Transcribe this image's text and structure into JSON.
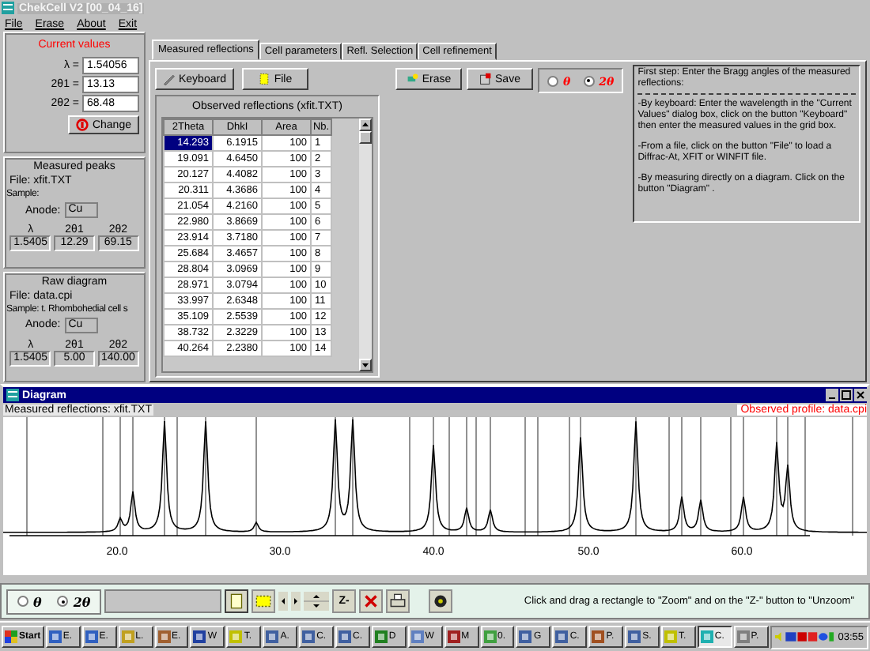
{
  "window": {
    "title": "ChekCell V2 [00_04_16]"
  },
  "menu": [
    "File",
    "Erase",
    "About",
    "Exit"
  ],
  "current_values": {
    "title": "Current values",
    "fields": [
      {
        "label": "λ =",
        "value": "1.54056"
      },
      {
        "label": "2θ1 =",
        "value": "13.13"
      },
      {
        "label": "2θ2 =",
        "value": "68.48"
      }
    ],
    "button": "Change"
  },
  "measured_peaks": {
    "title": "Measured peaks",
    "file": "File: xfit.TXT",
    "sample": "Sample:",
    "anode_label": "Anode:",
    "anode": "Cu",
    "columns": [
      "λ",
      "2θ1",
      "2θ2"
    ],
    "values": [
      "1.5405",
      "12.29",
      "69.15"
    ]
  },
  "raw_diagram": {
    "title": "Raw diagram",
    "file": "File: data.cpi",
    "sample": "Sample: t. Rhombohedial cell s",
    "anode_label": "Anode:",
    "anode": "Cu",
    "columns": [
      "λ",
      "2θ1",
      "2θ2"
    ],
    "values": [
      "1.5405",
      "5.00",
      "140.00"
    ]
  },
  "tabs": [
    {
      "label": "Measured reflections",
      "selected": true
    },
    {
      "label": "Cell parameters",
      "selected": false
    },
    {
      "label": "Refl. Selection",
      "selected": false
    },
    {
      "label": "Cell refinement",
      "selected": false
    }
  ],
  "buttons": [
    "Keyboard",
    "File",
    "Erase",
    "Save"
  ],
  "angle_mode": [
    {
      "label": "θ",
      "selected": false
    },
    {
      "label": "2θ",
      "selected": true
    }
  ],
  "table": {
    "title": "Observed reflections (xfit.TXT)",
    "columns": [
      "2Theta",
      "DhkI",
      "Area",
      "Nb."
    ],
    "rows": [
      {
        "cells": [
          "14.293",
          "6.1915",
          "100",
          "1"
        ],
        "selected": true
      },
      {
        "cells": [
          "19.091",
          "4.6450",
          "100",
          "2"
        ],
        "selected": false
      },
      {
        "cells": [
          "20.127",
          "4.4082",
          "100",
          "3"
        ],
        "selected": false
      },
      {
        "cells": [
          "20.311",
          "4.3686",
          "100",
          "4"
        ],
        "selected": false
      },
      {
        "cells": [
          "21.054",
          "4.2160",
          "100",
          "5"
        ],
        "selected": false
      },
      {
        "cells": [
          "22.980",
          "3.8669",
          "100",
          "6"
        ],
        "selected": false
      },
      {
        "cells": [
          "23.914",
          "3.7180",
          "100",
          "7"
        ],
        "selected": false
      },
      {
        "cells": [
          "25.684",
          "3.4657",
          "100",
          "8"
        ],
        "selected": false
      },
      {
        "cells": [
          "28.804",
          "3.0969",
          "100",
          "9"
        ],
        "selected": false
      },
      {
        "cells": [
          "28.971",
          "3.0794",
          "100",
          "10"
        ],
        "selected": false
      },
      {
        "cells": [
          "33.997",
          "2.6348",
          "100",
          "11"
        ],
        "selected": false
      },
      {
        "cells": [
          "35.109",
          "2.5539",
          "100",
          "12"
        ],
        "selected": false
      },
      {
        "cells": [
          "38.732",
          "2.3229",
          "100",
          "13"
        ],
        "selected": false
      },
      {
        "cells": [
          "40.264",
          "2.2380",
          "100",
          "14"
        ],
        "selected": false
      }
    ]
  },
  "instructions": [
    "First step: Enter the Bragg angles of the measured reflections:",
    "-By keyboard: Enter the wavelength in the \"Current Values\" dialog box, click on the button \"Keyboard\" then enter  the measured values in the grid box.",
    "-From a  file, click on the  button \"File\" to load a Diffrac-At, XFIT or WINFIT file.",
    "-By measuring directly on a diagram. Click on the button \"Diagram\" ."
  ],
  "diagram": {
    "title": "Diagram",
    "left_caption": "Measured reflections: xfit.TXT",
    "right_caption": "Observed profile: data.cpi",
    "x_ticks": [
      "20.0",
      "30.0",
      "40.0",
      "50.0",
      "60.0"
    ]
  },
  "bottom_mode": [
    {
      "label": "θ",
      "selected": false
    },
    {
      "label": "2θ",
      "selected": true
    }
  ],
  "zoom_button": "Z-",
  "status": "Click and drag a rectangle to \"Zoom\" and  on the \"Z-\" button to \"Unzoom\"",
  "taskbar": {
    "start": "Start",
    "items": [
      {
        "label": "E.",
        "selected": false
      },
      {
        "label": "E.",
        "selected": false
      },
      {
        "label": "L.",
        "selected": false
      },
      {
        "label": "E.",
        "selected": false
      },
      {
        "label": "W",
        "selected": false
      },
      {
        "label": "T.",
        "selected": false
      },
      {
        "label": "A.",
        "selected": false
      },
      {
        "label": "C.",
        "selected": false
      },
      {
        "label": "C.",
        "selected": false
      },
      {
        "label": "D",
        "selected": false
      },
      {
        "label": "W",
        "selected": false
      },
      {
        "label": "M",
        "selected": false
      },
      {
        "label": "0.",
        "selected": false
      },
      {
        "label": "G",
        "selected": false
      },
      {
        "label": "C.",
        "selected": false
      },
      {
        "label": "P.",
        "selected": false
      },
      {
        "label": "S.",
        "selected": false
      },
      {
        "label": "T.",
        "selected": false
      },
      {
        "label": "C.",
        "selected": true
      },
      {
        "label": "P.",
        "selected": false
      }
    ],
    "clock": "03:55"
  }
}
